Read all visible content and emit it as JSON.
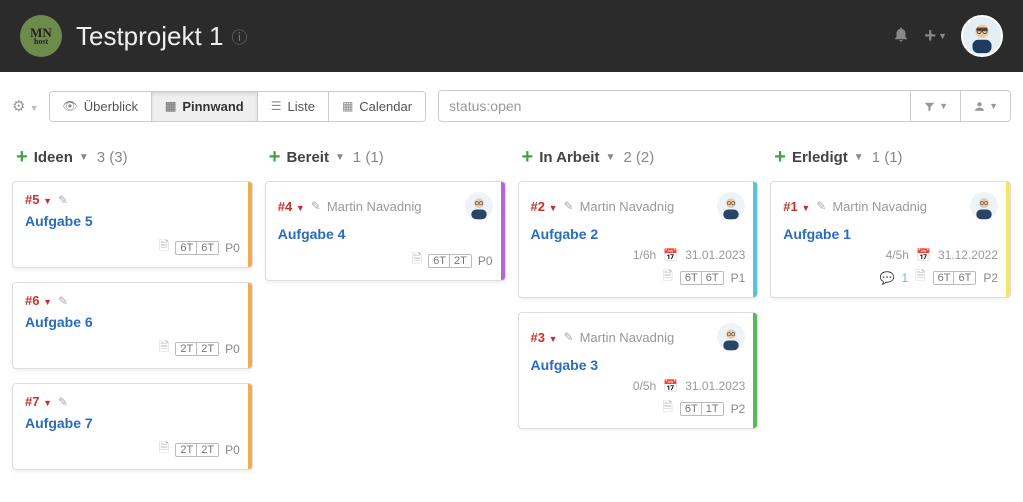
{
  "header": {
    "project_title": "Testprojekt 1"
  },
  "toolbar": {
    "tabs": {
      "overview": "Überblick",
      "board": "Pinnwand",
      "list": "Liste",
      "calendar": "Calendar"
    },
    "search_placeholder": "status:open"
  },
  "columns": [
    {
      "name": "Ideen",
      "count": "3 (3)",
      "cards": [
        {
          "id": "#5",
          "title": "Aufgabe 5",
          "time": [
            "6T",
            "6T"
          ],
          "prio": "P0",
          "stripe": "orange"
        },
        {
          "id": "#6",
          "title": "Aufgabe 6",
          "time": [
            "2T",
            "2T"
          ],
          "prio": "P0",
          "stripe": "orange"
        },
        {
          "id": "#7",
          "title": "Aufgabe 7",
          "time": [
            "2T",
            "2T"
          ],
          "prio": "P0",
          "stripe": "orange"
        }
      ]
    },
    {
      "name": "Bereit",
      "count": "1 (1)",
      "cards": [
        {
          "id": "#4",
          "title": "Aufgabe 4",
          "assignee": "Martin Navadnig",
          "time": [
            "6T",
            "2T"
          ],
          "prio": "P0",
          "stripe": "purple"
        }
      ]
    },
    {
      "name": "In Arbeit",
      "count": "2 (2)",
      "cards": [
        {
          "id": "#2",
          "title": "Aufgabe 2",
          "assignee": "Martin Navadnig",
          "hours": "1/6h",
          "due": "31.01.2023",
          "time": [
            "6T",
            "6T"
          ],
          "prio": "P1",
          "stripe": "blue"
        },
        {
          "id": "#3",
          "title": "Aufgabe 3",
          "assignee": "Martin Navadnig",
          "hours": "0/5h",
          "due": "31.01.2023",
          "time": [
            "6T",
            "1T"
          ],
          "prio": "P2",
          "stripe": "green"
        }
      ]
    },
    {
      "name": "Erledigt",
      "count": "1 (1)",
      "cards": [
        {
          "id": "#1",
          "title": "Aufgabe 1",
          "assignee": "Martin Navadnig",
          "hours": "4/5h",
          "due": "31.12.2022",
          "comments": "1",
          "time": [
            "6T",
            "6T"
          ],
          "prio": "P2",
          "stripe": "yellow"
        }
      ]
    }
  ]
}
